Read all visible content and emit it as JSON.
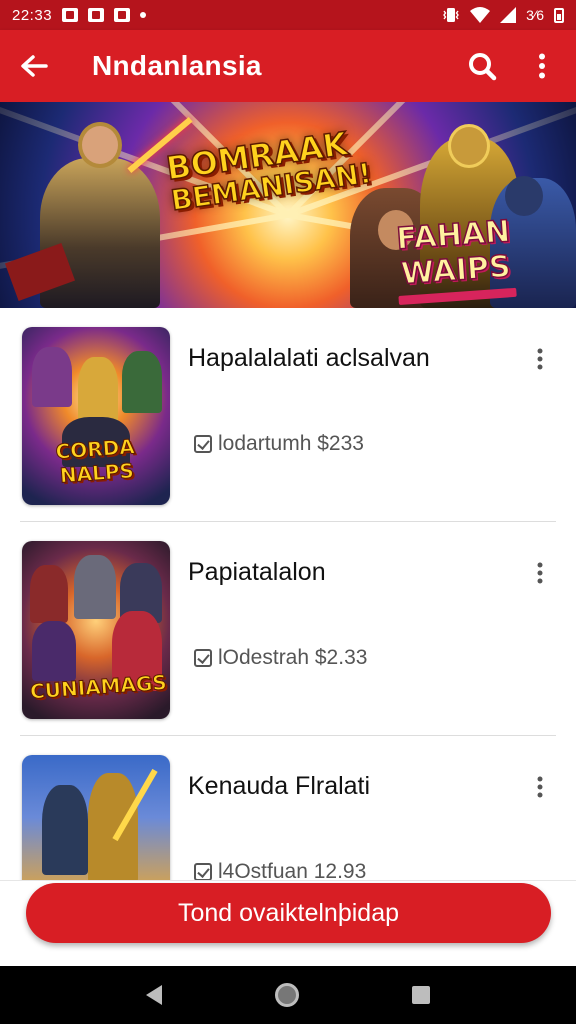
{
  "status_bar": {
    "time": "22:33",
    "battery_text": "3⁄6",
    "icons": [
      "notification-icon",
      "notification-icon",
      "notification-icon",
      "dot-icon",
      "vibrate-icon",
      "wifi-icon",
      "signal-icon",
      "battery-icon"
    ]
  },
  "app_bar": {
    "title": "Nndanlansia",
    "back_icon": "arrow-left-icon",
    "search_icon": "search-icon",
    "more_icon": "more-vert-icon"
  },
  "banner": {
    "title_line1": "BOMRAAK",
    "title_line2": "BEMANISAN!",
    "subtitle": "FAHAN WAIPS"
  },
  "items": [
    {
      "title": "Hapalalalati aclsalvan",
      "meta": "lodartumh $233",
      "thumb_label": "CORDA NALPS"
    },
    {
      "title": "Papiatalalon",
      "meta": "lOdestrah $2.33",
      "thumb_label": "CUNIAMAGS"
    },
    {
      "title": "Kenauda Flralati",
      "meta": "l4Ostfuan 12.93",
      "thumb_label": ""
    }
  ],
  "cta": {
    "label": "Tond ovaiktelnþidap"
  },
  "colors": {
    "primary": "#d81e24",
    "status_bar": "#b5141c",
    "cta": "#d81e24"
  }
}
